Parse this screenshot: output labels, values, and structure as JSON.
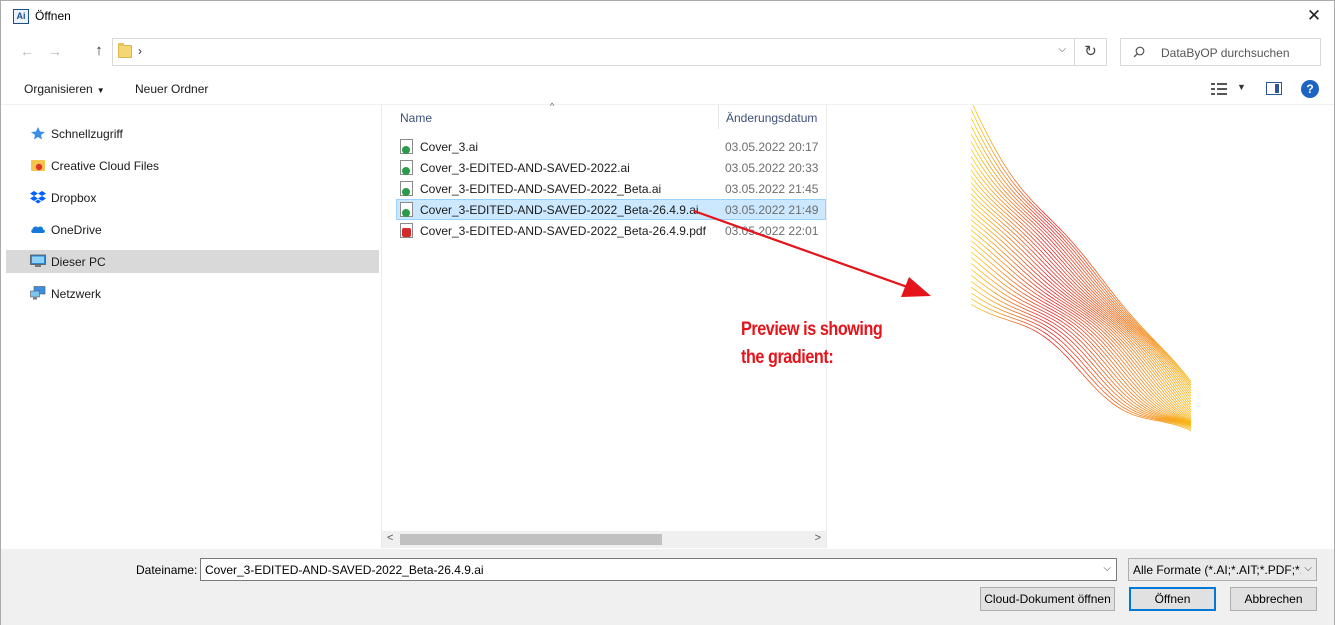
{
  "window": {
    "title": "Öffnen",
    "app_icon_text": "Ai"
  },
  "address": {
    "separator": "›",
    "search_placeholder": "DataByOP durchsuchen"
  },
  "toolbar": {
    "organize_label": "Organisieren",
    "new_folder_label": "Neuer Ordner"
  },
  "sidebar": {
    "items": [
      {
        "label": "Schnellzugriff",
        "icon": "star-icon"
      },
      {
        "label": "Creative Cloud Files",
        "icon": "creative-cloud-folder-icon"
      },
      {
        "label": "Dropbox",
        "icon": "dropbox-icon"
      },
      {
        "label": "OneDrive",
        "icon": "cloud-icon"
      },
      {
        "label": "Dieser PC",
        "icon": "computer-icon",
        "selected": true
      },
      {
        "label": "Netzwerk",
        "icon": "network-icon"
      }
    ]
  },
  "filelist": {
    "columns": {
      "name": "Name",
      "date": "Änderungsdatum"
    },
    "files": [
      {
        "name": "Cover_3.ai",
        "date": "03.05.2022 20:17",
        "type": "ai"
      },
      {
        "name": "Cover_3-EDITED-AND-SAVED-2022.ai",
        "date": "03.05.2022 20:33",
        "type": "ai"
      },
      {
        "name": "Cover_3-EDITED-AND-SAVED-2022_Beta.ai",
        "date": "03.05.2022 21:45",
        "type": "ai"
      },
      {
        "name": "Cover_3-EDITED-AND-SAVED-2022_Beta-26.4.9.ai",
        "date": "03.05.2022 21:49",
        "type": "ai",
        "selected": true
      },
      {
        "name": "Cover_3-EDITED-AND-SAVED-2022_Beta-26.4.9.pdf",
        "date": "03.05.2022 22:01",
        "type": "pdf"
      }
    ]
  },
  "annotation": {
    "line1": "Preview is showing",
    "line2": "the gradient:",
    "color": "#e4141a"
  },
  "bottom": {
    "filename_label": "Dateiname:",
    "filename_value": "Cover_3-EDITED-AND-SAVED-2022_Beta-26.4.9.ai",
    "filter_value": "Alle Formate (*.AI;*.AIT;*.PDF;*.",
    "cloud_button": "Cloud-Dokument öffnen",
    "open_button": "Öffnen",
    "cancel_button": "Abbrechen"
  }
}
